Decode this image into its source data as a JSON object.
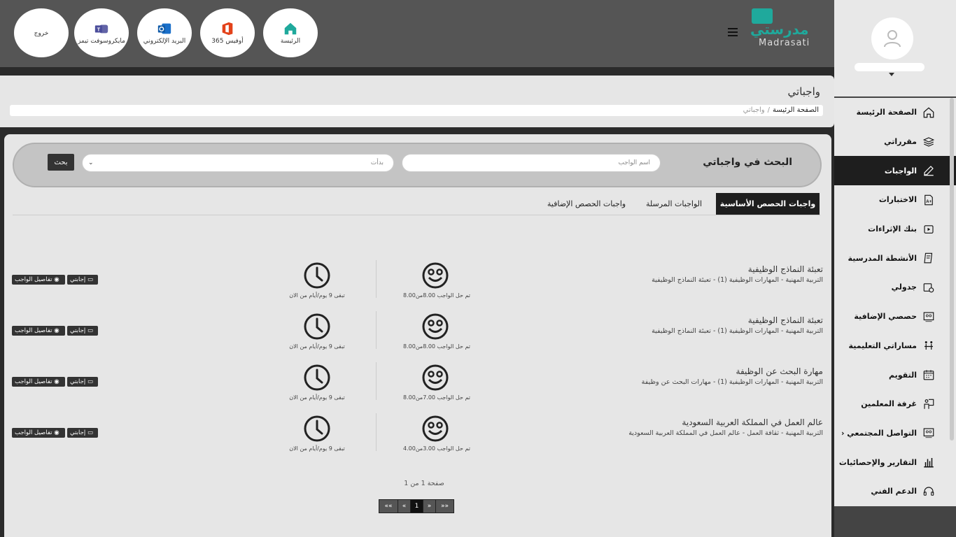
{
  "header": {
    "buttons": {
      "home": "الرئيسة",
      "office": "أوفيس 365",
      "mail": "البريد الإلكتروني",
      "teams": "مايكروسوفت تيمز",
      "logout": "خروج"
    },
    "logo_ar": "مدرستي",
    "logo_en": "Madrasati"
  },
  "sidebar": {
    "items": [
      {
        "label": "الصفحة الرئيسة",
        "icon": "home-icon"
      },
      {
        "label": "مقرراتي",
        "icon": "books-icon"
      },
      {
        "label": "الواجبات",
        "icon": "edit-icon"
      },
      {
        "label": "الاختبارات",
        "icon": "exam-icon"
      },
      {
        "label": "بنك الإثراءات",
        "icon": "video-icon"
      },
      {
        "label": "الأنشطة المدرسية",
        "icon": "notebook-icon"
      },
      {
        "label": "جدولي",
        "icon": "calendar-clock-icon"
      },
      {
        "label": "حصصي الإضافية",
        "icon": "board-icon"
      },
      {
        "label": "مساراتي التعليمية",
        "icon": "path-icon"
      },
      {
        "label": "التقويم",
        "icon": "calendar-icon"
      },
      {
        "label": "غرفة المعلمين",
        "icon": "teacher-icon"
      },
      {
        "label": "التواصل المجتمعي",
        "icon": "community-icon"
      },
      {
        "label": "التقارير والإحصائيات",
        "icon": "chart-icon"
      },
      {
        "label": "الدعم الفني",
        "icon": "headset-icon"
      }
    ],
    "active_index": 2
  },
  "page": {
    "title": "واجباتي",
    "breadcrumb_home": "الصفحة الرئيسة",
    "breadcrumb_sep": "/",
    "breadcrumb_current": "واجباتي"
  },
  "search": {
    "title": "البحث في واجباتي",
    "name_placeholder": "اسم الواجب",
    "select_value": "بدأت",
    "button": "بحث"
  },
  "tabs": [
    "واجبات الحصص الأساسية",
    "الواجبات المرسلة",
    "واجبات الحصص الإضافية"
  ],
  "assignments": [
    {
      "title": "تعبئة النماذج الوظيفية",
      "subtitle": "التربية المهنية - المهارات الوظيفية (1) - تعبئة النماذج الوظيفية",
      "grade": "تم حل الواجب 8.00من8.00",
      "remaining": "تبقى 9 يوم/أيام من الان"
    },
    {
      "title": "تعبئة النماذج الوظيفية",
      "subtitle": "التربية المهنية - المهارات الوظيفية (1) - تعبئة النماذج الوظيفية",
      "grade": "تم حل الواجب 8.00من8.00",
      "remaining": "تبقى 9 يوم/أيام من الان"
    },
    {
      "title": "مهارة البحث عن الوظيفة",
      "subtitle": "التربية المهنية - المهارات الوظيفية (1) - مهارات البحث عن وظيفة",
      "grade": "تم حل الواجب 7.00من8.00",
      "remaining": "تبقى 9 يوم/أيام من الان"
    },
    {
      "title": "عالم العمل في المملكة العربية السعودية",
      "subtitle": "التربية المهنية - ثقافة العمل - عالم العمل في المملكة العربية السعودية",
      "grade": "تم حل الواجب 3.00من4.00",
      "remaining": "تبقى 9 يوم/أيام من الان"
    }
  ],
  "actions": {
    "answers": "إجابتي",
    "details": "تفاصيل الواجب"
  },
  "pagination": {
    "text": "صفحة 1 من 1",
    "first": "««",
    "prev": "«",
    "current": "1",
    "next": "»",
    "last": "»»"
  }
}
